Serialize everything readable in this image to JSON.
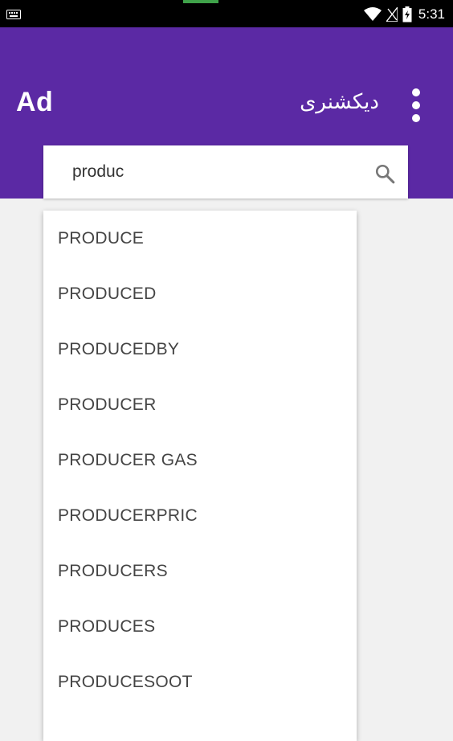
{
  "status_bar": {
    "time": "5:31",
    "icons": [
      "keyboard-icon",
      "wifi-icon",
      "no-signal-icon",
      "battery-charging-icon"
    ]
  },
  "app_bar": {
    "logo": "Ad",
    "title": "دیکشنری",
    "background_color": "#5b29a4"
  },
  "search": {
    "value": "produc",
    "icon": "search-icon"
  },
  "suggestions": [
    "PRODUCE",
    "PRODUCED",
    "PRODUCEDBY",
    "PRODUCER",
    "PRODUCER GAS",
    "PRODUCERPRIC",
    "PRODUCERS",
    "PRODUCES",
    "PRODUCESOOT"
  ]
}
